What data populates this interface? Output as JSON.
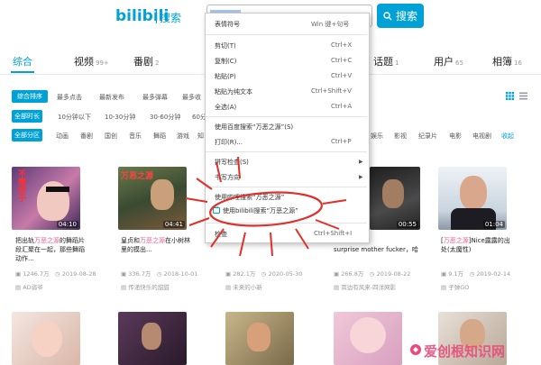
{
  "header": {
    "logo_text": "bilibili",
    "logo_sub": "搜索",
    "search_button_label": "搜索"
  },
  "tabs": [
    {
      "label": "综合",
      "count": ""
    },
    {
      "label": "视频",
      "count": "99+"
    },
    {
      "label": "番剧",
      "count": "2"
    },
    {
      "label": "话题",
      "count": "1"
    },
    {
      "label": "用户",
      "count": "65"
    },
    {
      "label": "相簿",
      "count": "16"
    }
  ],
  "filters": {
    "sort": {
      "active": "综合排序",
      "options": [
        "最多点击",
        "最新发布",
        "最多弹幕",
        "最多收"
      ]
    },
    "duration": {
      "active": "全部时长",
      "options": [
        "10分钟以下",
        "10-30分钟",
        "30-60分钟",
        "60分钟"
      ]
    },
    "zone": {
      "active": "全部分区",
      "options": [
        "动画",
        "番剧",
        "国创",
        "音乐",
        "舞蹈",
        "游戏",
        "知"
      ],
      "right_options": [
        "娱乐",
        "影视",
        "纪录片",
        "电影",
        "电视剧",
        "收起"
      ]
    }
  },
  "videos": [
    {
      "title_pre": "把出轨",
      "title_hl": "万恶之源",
      "title_post": "的舞蹈片段汇聚在一起，那些舞蹈动作...",
      "views": "1246.7万",
      "date": "2019-08-28",
      "uploader": "AD弱爷",
      "duration": "04:10",
      "thumb_text": "不懂样子"
    },
    {
      "title_pre": "皇贞和",
      "title_hl": "万恶之源",
      "title_post": "在小树林里的摸出...",
      "views": "336.7万",
      "date": "2018-10-01",
      "uploader": "传递快乐的甜甜",
      "duration": "04:41",
      "thumb_text": "万恶之源"
    },
    {
      "title_pre": "",
      "title_hl": "",
      "title_post": "",
      "views": "282.1万",
      "date": "2020-05-30",
      "uploader": "未来的小新",
      "duration": "",
      "thumb_text": ""
    },
    {
      "title_pre": "",
      "title_hl": "",
      "title_post": "surprise mother fucker，哈",
      "views": "266.8万",
      "date": "2019-08-22",
      "uploader": "耳边有风来-四洋网影",
      "duration": "00:55",
      "thumb_text": ""
    },
    {
      "title_pre": "[",
      "title_hl": "万恶之源",
      "title_post": "]Nice露露的出处(太魔性)",
      "views": "9.1万",
      "date": "2019-02-14",
      "uploader": "子弹GO",
      "duration": "01:04",
      "thumb_text": ""
    }
  ],
  "context_menu": [
    {
      "label": "表情符号",
      "shortcut": "Win 键+句号",
      "disabled": false
    },
    {
      "label": "剪切(T)",
      "shortcut": "Ctrl+X",
      "disabled": false
    },
    {
      "label": "复制(C)",
      "shortcut": "Ctrl+C",
      "disabled": false
    },
    {
      "label": "粘贴(P)",
      "shortcut": "Ctrl+V",
      "disabled": false
    },
    {
      "label": "粘贴为纯文本",
      "shortcut": "Ctrl+Shift+V",
      "disabled": false
    },
    {
      "label": "全选(A)",
      "shortcut": "Ctrl+A",
      "disabled": false
    },
    {
      "label": "使用百度搜索“万恶之源”(S)",
      "shortcut": "",
      "disabled": false
    },
    {
      "label": "打印(R)...",
      "shortcut": "Ctrl+P",
      "disabled": false
    },
    {
      "label": "拼写检查(S)",
      "shortcut": "",
      "disabled": false
    },
    {
      "label": "书写方向",
      "shortcut": "",
      "disabled": false
    },
    {
      "label": "使用哔哩搜索“万恶之源”",
      "shortcut": "",
      "disabled": false
    },
    {
      "label": "使用bilibili搜索“万恶之源”",
      "shortcut": "",
      "disabled": false
    },
    {
      "label": "检查",
      "shortcut": "Ctrl+Shift+I",
      "disabled": false
    }
  ],
  "watermark": "爱创根知识网",
  "colors": {
    "accent": "#00a1d6",
    "highlight": "#f25d8e",
    "annotation": "#e0302a"
  }
}
